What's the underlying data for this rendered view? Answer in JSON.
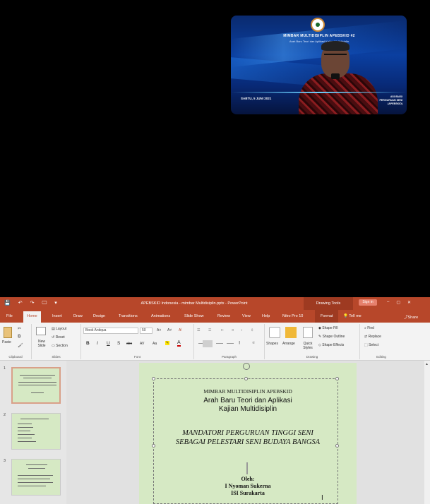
{
  "video": {
    "title": "MIMBAR MULTIDISIPLIN APEBSKID #2",
    "subtitle": "Arah Baru Teori dan Aplikasi Kajian Multidisiplin",
    "date": "SABTU, 5 JUNI 2021",
    "right_caption": "ASOSIASI PERGURUAN SENI (APEBSKID)"
  },
  "window": {
    "title": "APEBSKID Indonesia - mimbar Multidisiplin.pptx - PowerPoint",
    "contextual": "Drawing Tools",
    "signin": "Sign in",
    "controls": [
      "–",
      "▢",
      "✕"
    ]
  },
  "quick_access": [
    "💾",
    "↶",
    "↷",
    "🖵",
    "▾"
  ],
  "tabs": [
    {
      "label": "File"
    },
    {
      "label": "Home"
    },
    {
      "label": "Insert"
    },
    {
      "label": "Draw"
    },
    {
      "label": "Design"
    },
    {
      "label": "Transitions"
    },
    {
      "label": "Animations"
    },
    {
      "label": "Slide Show"
    },
    {
      "label": "Review"
    },
    {
      "label": "View"
    },
    {
      "label": "Help"
    },
    {
      "label": "Nitro Pro 10"
    },
    {
      "label": "Format"
    }
  ],
  "tell_me": "Tell me",
  "share": "Share",
  "ribbon": {
    "paste": "Paste",
    "new_slide": "New Slide",
    "layout": "Layout",
    "reset": "Reset",
    "section": "Section",
    "font_name": "Book Antiqua",
    "font_size": "50",
    "bold": "B",
    "italic": "I",
    "underline": "U",
    "shadow": "S",
    "strike": "abc",
    "spacing": "AV",
    "case": "Aa",
    "shapes": "Shapes",
    "arrange": "Arrange",
    "quick_styles": "Quick Styles",
    "shape_fill": "Shape Fill",
    "shape_outline": "Shape Outline",
    "shape_effects": "Shape Effects",
    "find": "Find",
    "replace": "Replace",
    "select": "Select",
    "groups": [
      "Clipboard",
      "Slides",
      "Font",
      "Paragraph",
      "Drawing",
      "Editing"
    ]
  },
  "thumbnails": [
    {
      "num": "1"
    },
    {
      "num": "2"
    },
    {
      "num": "3"
    }
  ],
  "slide": {
    "line1": "MIMBAR MULTIDISIPLIN APEBSKID",
    "line2a": "Arah Baru Teori dan Aplikasi",
    "line2b": "Kajian Multidisiplin",
    "line3a": "MANDATORI PERGURUAN TINGGI SENI",
    "line3b": "SEBAGAI PELESTARI SENI BUDAYA BANGSA",
    "oleh": "Oleh:",
    "author": "I Nyoman Sukerna",
    "institution": "ISI Surakarta"
  },
  "colors": {
    "ppt_accent": "#b7472a",
    "slide_bg": "#d6e9c4",
    "video_bg": "#0b3fa0"
  }
}
